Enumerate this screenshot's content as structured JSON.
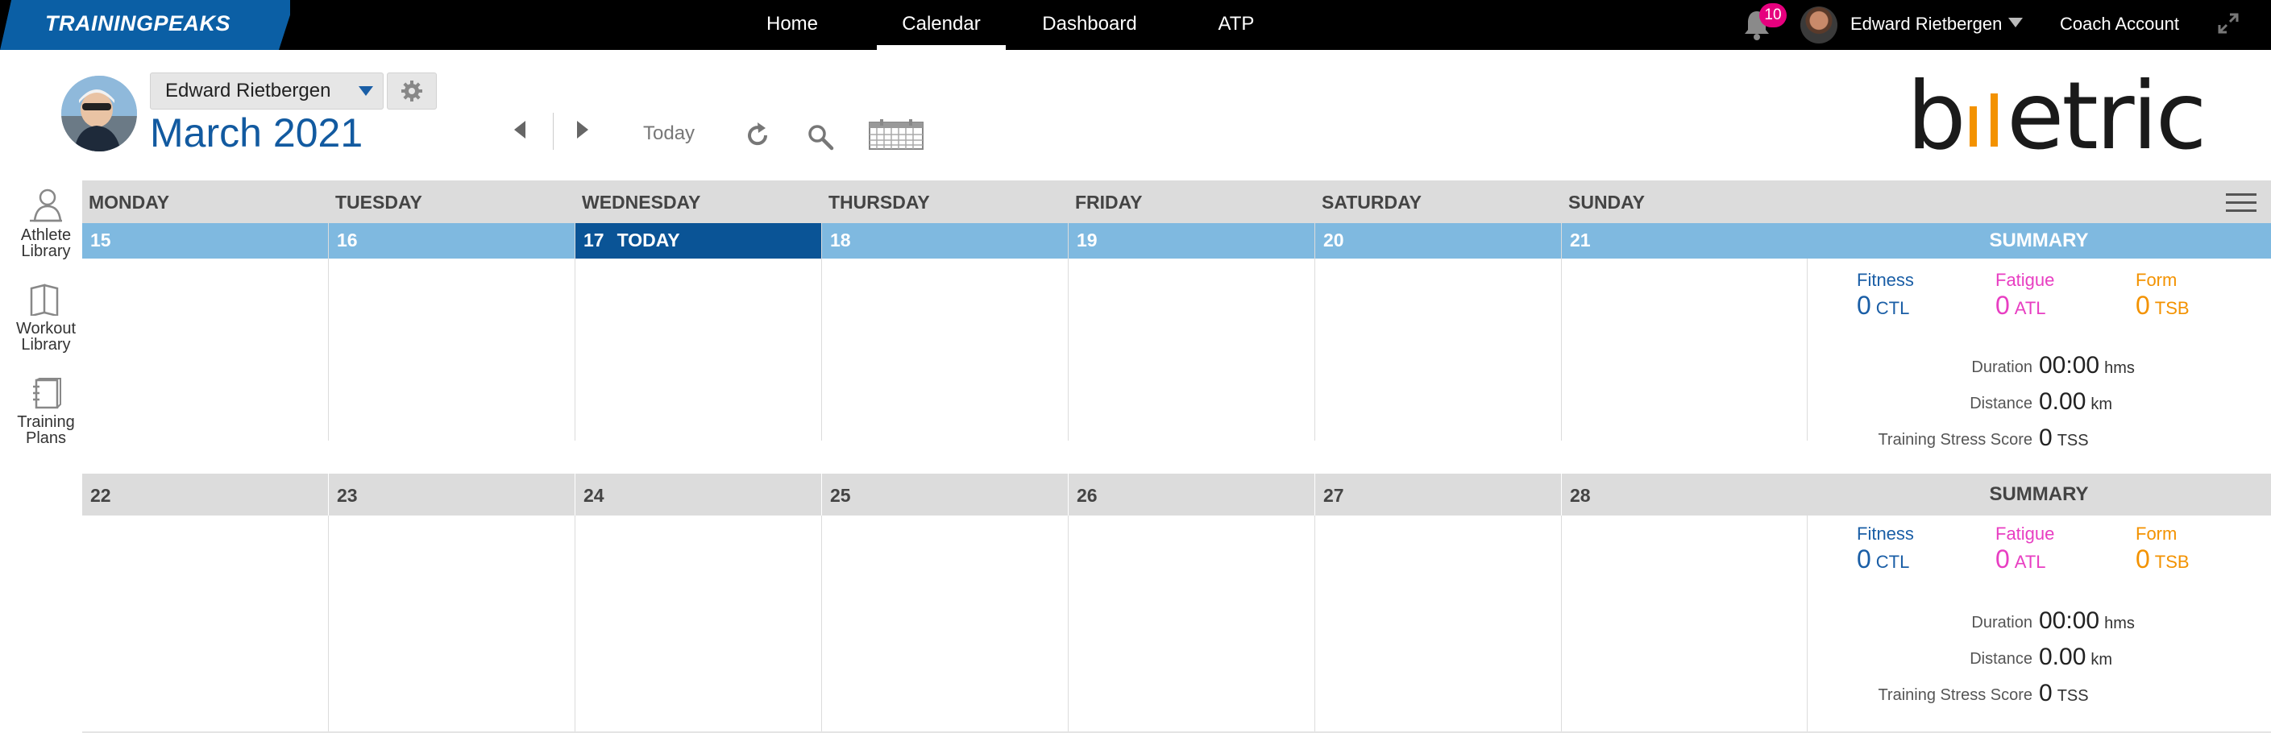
{
  "nav": {
    "logo": "TRAININGPEAKS",
    "items": [
      {
        "label": "Home",
        "active": false
      },
      {
        "label": "Calendar",
        "active": true
      },
      {
        "label": "Dashboard",
        "active": false
      },
      {
        "label": "ATP",
        "active": false
      }
    ],
    "notification_count": "10",
    "user_name": "Edward Rietbergen",
    "coach_account": "Coach Account"
  },
  "header": {
    "athlete_select": "Edward Rietbergen",
    "month": "March",
    "year": "2021",
    "today_button": "Today",
    "brand": "bmetric"
  },
  "sidebar": {
    "items": [
      {
        "line1": "Athlete",
        "line2": "Library",
        "icon": "athlete-library-icon"
      },
      {
        "line1": "Workout",
        "line2": "Library",
        "icon": "workout-library-icon"
      },
      {
        "line1": "Training",
        "line2": "Plans",
        "icon": "training-plans-icon"
      }
    ]
  },
  "calendar": {
    "days_of_week": [
      "MONDAY",
      "TUESDAY",
      "WEDNESDAY",
      "THURSDAY",
      "FRIDAY",
      "SATURDAY",
      "SUNDAY"
    ],
    "today_label": "TODAY",
    "weeks": [
      {
        "dates": [
          "15",
          "16",
          "17",
          "18",
          "19",
          "20",
          "21"
        ],
        "today_index": 2,
        "summary": {
          "title": "SUMMARY",
          "fitness_label": "Fitness",
          "fitness_value": "0",
          "fitness_unit": "CTL",
          "fatigue_label": "Fatigue",
          "fatigue_value": "0",
          "fatigue_unit": "ATL",
          "form_label": "Form",
          "form_value": "0",
          "form_unit": "TSB",
          "duration_label": "Duration",
          "duration_value": "00:00",
          "duration_unit": "hms",
          "distance_label": "Distance",
          "distance_value": "0.00",
          "distance_unit": "km",
          "tss_label": "Training Stress Score",
          "tss_value": "0",
          "tss_unit": "TSS"
        }
      },
      {
        "dates": [
          "22",
          "23",
          "24",
          "25",
          "26",
          "27",
          "28"
        ],
        "today_index": -1,
        "summary": {
          "title": "SUMMARY",
          "fitness_label": "Fitness",
          "fitness_value": "0",
          "fitness_unit": "CTL",
          "fatigue_label": "Fatigue",
          "fatigue_value": "0",
          "fatigue_unit": "ATL",
          "form_label": "Form",
          "form_value": "0",
          "form_unit": "TSB",
          "duration_label": "Duration",
          "duration_value": "00:00",
          "duration_unit": "hms",
          "distance_label": "Distance",
          "distance_value": "0.00",
          "distance_unit": "km",
          "tss_label": "Training Stress Score",
          "tss_value": "0",
          "tss_unit": "TSS"
        }
      }
    ]
  },
  "colors": {
    "brand_blue": "#0b5fa5",
    "date_strip_blue": "#7fb9e0",
    "today_blue": "#0a5496",
    "fitness": "#1a5ea6",
    "fatigue": "#e83ec2",
    "form": "#f39200",
    "badge": "#e6007e"
  }
}
